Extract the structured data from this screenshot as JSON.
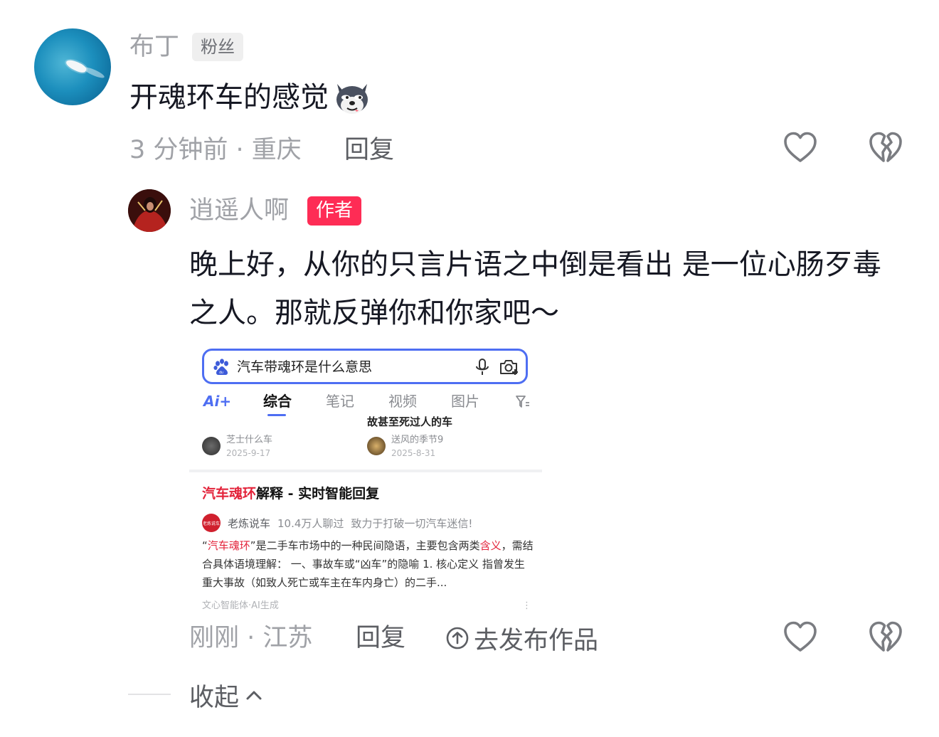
{
  "comment": {
    "username": "布丁",
    "badge": "粉丝",
    "text": "开魂环车的感觉",
    "emoji": "wolf-emoji",
    "time_location": "3 分钟前 · 重庆",
    "reply_label": "回复"
  },
  "reply": {
    "username": "逍遥人啊",
    "badge": "作者",
    "text": "晚上好，从你的只言片语之中倒是看出 是一位心肠歹毒之人。那就反弹你和你家吧～",
    "time_location": "刚刚 · 江苏",
    "reply_label": "回复",
    "publish_label": "去发布作品"
  },
  "screenshot": {
    "search_query": "汽车带魂环是什么意思",
    "tabs": [
      "Ai+",
      "综合",
      "笔记",
      "视频",
      "图片"
    ],
    "active_tab": "综合",
    "related_title": "故甚至死过人的车",
    "authors": [
      {
        "name": "芝士什么车",
        "date": "2025-9-17"
      },
      {
        "name": "送风的季节9",
        "date": "2025-8-31"
      }
    ],
    "result_title_highlight": "汽车魂环",
    "result_title_rest": "解释 - 实时智能回复",
    "source_logo_text": "老炼说车",
    "source_name": "老炼说车",
    "source_stats": "10.4万人聊过",
    "source_slogan": "致力于打破一切汽车迷信!",
    "body_q_open": "“",
    "body_hl1": "汽车魂环",
    "body_mid": "”是二手车市场中的一种民间隐语，主要包含两类",
    "body_hl2": "含义",
    "body_rest": "，需结合具体语境理解： 一、事故车或“凶车”的隐喻 1. 核心定义 指曾发生重大事故（如致人死亡或车主在车内身亡）的二手...",
    "footer": "文心智能体·AI生成",
    "more": "⋮"
  },
  "collapse_label": "收起",
  "colors": {
    "author_badge": "#fe2c55",
    "meta_gray": "#a0a2a7",
    "baidu_blue": "#4e6ef2",
    "highlight_red": "#e3243b"
  }
}
